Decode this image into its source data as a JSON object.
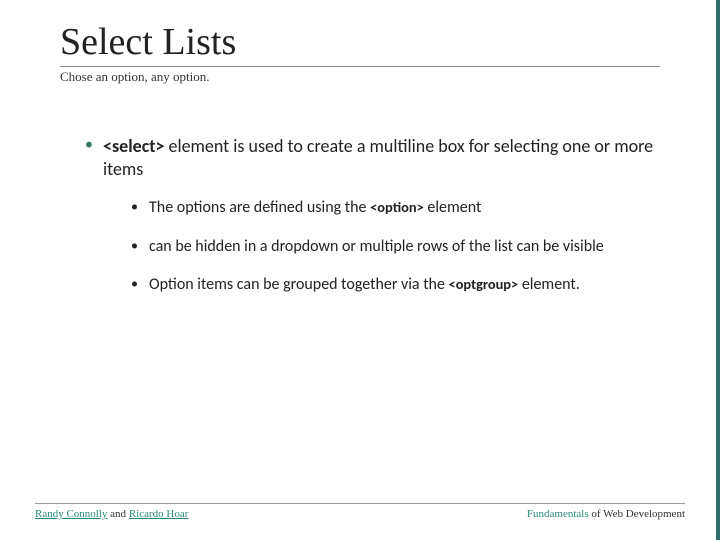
{
  "title": "Select Lists",
  "subtitle": "Chose an option, any option.",
  "bullet1_a": "<select>",
  "bullet1_b": " element is used to create a multiline box for selecting one or more items",
  "sub1_a": "The options are defined using the ",
  "sub1_b": "<option>",
  "sub1_c": " element",
  "sub2": "can be hidden in a dropdown or multiple rows of the list can be visible",
  "sub3_a": "Option items can be grouped together via the ",
  "sub3_b": "<optgroup>",
  "sub3_c": " element.",
  "footer_left_a": "Randy Connolly",
  "footer_left_b": " and ",
  "footer_left_c": "Ricardo Hoar",
  "footer_right_a": "Fundamentals",
  "footer_right_b": " of Web Development"
}
